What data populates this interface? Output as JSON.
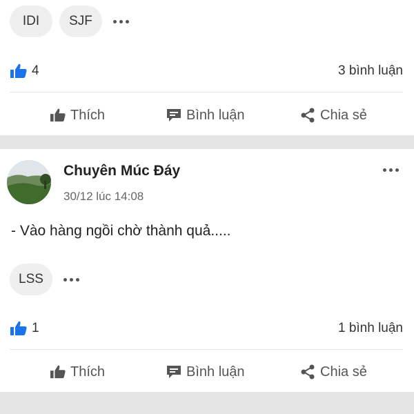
{
  "post1": {
    "reactions": [
      "IDI",
      "SJF"
    ],
    "like_count": "4",
    "comment_count": "3 bình luận"
  },
  "post2": {
    "author": "Chuyên Múc Đáy",
    "timestamp": "30/12 lúc 14:08",
    "text": "- Vào hàng ngồi chờ thành quả.....",
    "reactions": [
      "LSS"
    ],
    "like_count": "1",
    "comment_count": "1 bình luận"
  },
  "actions": {
    "like": "Thích",
    "comment": "Bình luận",
    "share": "Chia sẻ"
  },
  "colors": {
    "like_icon": "#1a73e8",
    "separator": "#e4e4e4",
    "chip_bg": "#efefef"
  },
  "icons": {
    "like": "thumbs-up-icon",
    "comment": "comment-bubble-icon",
    "share": "share-icon",
    "more": "more-horizontal-icon"
  }
}
